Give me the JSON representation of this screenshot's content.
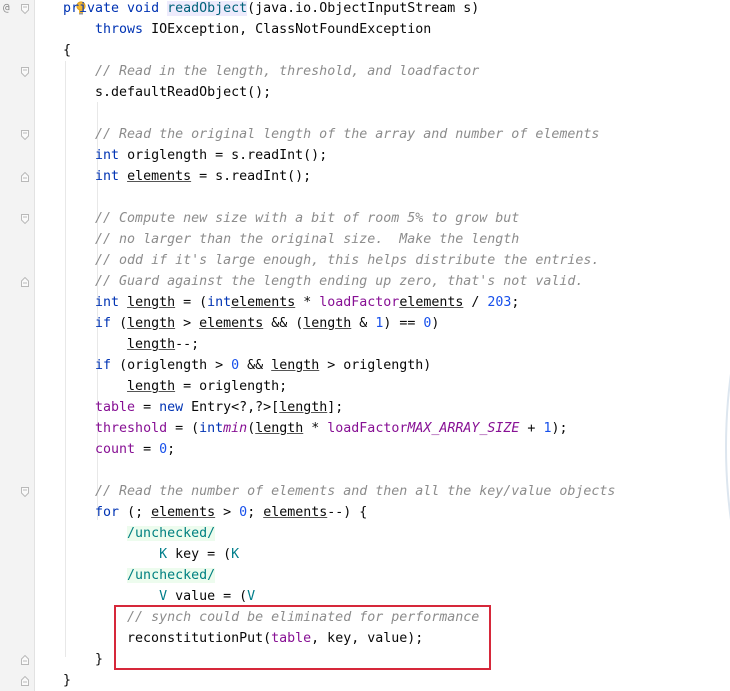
{
  "gutter": {
    "override_marker": "@"
  },
  "lines": [
    {
      "segs": [
        [
          "kw",
          "private "
        ],
        [
          "kw",
          "void "
        ],
        [
          "fn hl",
          "readObject"
        ],
        [
          "",
          "(java.io.ObjectInputStream s)"
        ]
      ]
    },
    {
      "segs": [
        [
          "",
          "    "
        ],
        [
          "kw",
          "throws "
        ],
        [
          "",
          "IOException, ClassNotFoundException"
        ]
      ]
    },
    {
      "segs": [
        [
          "",
          "{"
        ]
      ]
    },
    {
      "segs": [
        [
          "",
          "    "
        ],
        [
          "cm",
          "// Read in the length, threshold, and loadfactor"
        ]
      ]
    },
    {
      "segs": [
        [
          "",
          "    s.defaultReadObject();"
        ]
      ]
    },
    {
      "segs": [
        [
          "",
          ""
        ]
      ]
    },
    {
      "segs": [
        [
          "",
          "    "
        ],
        [
          "cm",
          "// Read the original length of the array and number of elements"
        ]
      ]
    },
    {
      "segs": [
        [
          "",
          "    "
        ],
        [
          "kw",
          "int "
        ],
        [
          "",
          "origlength = s.readInt();"
        ]
      ]
    },
    {
      "segs": [
        [
          "",
          "    "
        ],
        [
          "kw",
          "int "
        ],
        [
          "ul",
          "elements"
        ],
        [
          "",
          " = s.readInt();"
        ]
      ]
    },
    {
      "segs": [
        [
          "",
          ""
        ]
      ]
    },
    {
      "segs": [
        [
          "",
          "    "
        ],
        [
          "cm",
          "// Compute new size with a bit of room 5% to grow but"
        ]
      ]
    },
    {
      "segs": [
        [
          "",
          "    "
        ],
        [
          "cm",
          "// no larger than the original size.  Make the length"
        ]
      ]
    },
    {
      "segs": [
        [
          "",
          "    "
        ],
        [
          "cm",
          "// odd if it's large enough, this helps distribute the entries."
        ]
      ]
    },
    {
      "segs": [
        [
          "",
          "    "
        ],
        [
          "cm",
          "// Guard against the length ending up zero, that's not valid."
        ]
      ]
    },
    {
      "segs": [
        [
          "",
          "    "
        ],
        [
          "kw",
          "int "
        ],
        [
          "ul",
          "length"
        ],
        [
          "",
          " = ("
        ],
        [
          "kw",
          "int"
        ],
        [
          ")("
        ],
        [
          "ul",
          "elements"
        ],
        [
          "",
          " * "
        ],
        [
          "fld",
          "loadFactor"
        ],
        [
          ") + ("
        ],
        [
          "ul",
          "elements"
        ],
        [
          "",
          " / "
        ],
        [
          "num",
          "20"
        ],
        [
          ") + "
        ],
        [
          "num",
          "3"
        ],
        [
          "",
          ";"
        ]
      ]
    },
    {
      "segs": [
        [
          "",
          "    "
        ],
        [
          "kw",
          "if "
        ],
        [
          "",
          "("
        ],
        [
          "ul",
          "length"
        ],
        [
          "",
          " > "
        ],
        [
          "ul",
          "elements"
        ],
        [
          "",
          " && ("
        ],
        [
          "ul",
          "length"
        ],
        [
          "",
          " & "
        ],
        [
          "num",
          "1"
        ],
        [
          "",
          ") == "
        ],
        [
          "num",
          "0"
        ],
        [
          "",
          ")"
        ]
      ]
    },
    {
      "segs": [
        [
          "",
          "        "
        ],
        [
          "ul",
          "length"
        ],
        [
          "",
          "--;"
        ]
      ]
    },
    {
      "segs": [
        [
          "",
          "    "
        ],
        [
          "kw",
          "if "
        ],
        [
          "",
          "(origlength > "
        ],
        [
          "num",
          "0"
        ],
        [
          "",
          " && "
        ],
        [
          "ul",
          "length"
        ],
        [
          "",
          " > origlength)"
        ]
      ]
    },
    {
      "segs": [
        [
          "",
          "        "
        ],
        [
          "ul",
          "length"
        ],
        [
          "",
          " = origlength;"
        ]
      ]
    },
    {
      "segs": [
        [
          "",
          "    "
        ],
        [
          "fld",
          "table"
        ],
        [
          "",
          " = "
        ],
        [
          "kw",
          "new "
        ],
        [
          "",
          "Entry<?,?>["
        ],
        [
          "ul",
          "length"
        ],
        [
          "",
          "];"
        ]
      ]
    },
    {
      "segs": [
        [
          "",
          "    "
        ],
        [
          "fld",
          "threshold"
        ],
        [
          "",
          " = ("
        ],
        [
          "kw",
          "int"
        ],
        [
          ")Math."
        ],
        [
          "st",
          "min"
        ],
        [
          "",
          "("
        ],
        [
          "ul",
          "length"
        ],
        [
          "",
          " * "
        ],
        [
          "fld",
          "loadFactor"
        ],
        [
          ", "
        ],
        [
          "st",
          "MAX_ARRAY_SIZE"
        ],
        [
          "",
          " + "
        ],
        [
          "num",
          "1"
        ],
        [
          "",
          ");"
        ]
      ]
    },
    {
      "segs": [
        [
          "",
          "    "
        ],
        [
          "fld",
          "count"
        ],
        [
          "",
          " = "
        ],
        [
          "num",
          "0"
        ],
        [
          "",
          ";"
        ]
      ]
    },
    {
      "segs": [
        [
          "",
          ""
        ]
      ]
    },
    {
      "segs": [
        [
          "",
          "    "
        ],
        [
          "cm",
          "// Read the number of elements and then all the key/value objects"
        ]
      ]
    },
    {
      "segs": [
        [
          "",
          "    "
        ],
        [
          "kw",
          "for "
        ],
        [
          "",
          "(; "
        ],
        [
          "ul",
          "elements"
        ],
        [
          "",
          " > "
        ],
        [
          "num",
          "0"
        ],
        [
          "",
          "; "
        ],
        [
          "ul",
          "elements"
        ],
        [
          "",
          "--) {"
        ]
      ]
    },
    {
      "segs": [
        [
          "",
          "        "
        ],
        [
          "sup",
          "/unchecked/"
        ]
      ]
    },
    {
      "segs": [
        [
          "",
          "            "
        ],
        [
          "tp",
          "K"
        ],
        [
          "",
          " key = ("
        ],
        [
          "tp",
          "K"
        ],
        [
          ")s.readObject();"
        ]
      ]
    },
    {
      "segs": [
        [
          "",
          "        "
        ],
        [
          "sup",
          "/unchecked/"
        ]
      ]
    },
    {
      "segs": [
        [
          "",
          "            "
        ],
        [
          "tp",
          "V"
        ],
        [
          "",
          " value = ("
        ],
        [
          "tp",
          "V"
        ],
        [
          ")s.readObject();"
        ]
      ]
    },
    {
      "segs": [
        [
          "",
          "        "
        ],
        [
          "cm",
          "// synch could be eliminated for performance"
        ]
      ]
    },
    {
      "segs": [
        [
          "",
          "        reconstitutionPut("
        ],
        [
          "fld",
          "table"
        ],
        [
          "",
          ", key, value);"
        ]
      ]
    },
    {
      "segs": [
        [
          "",
          "    }"
        ]
      ]
    },
    {
      "segs": [
        [
          "",
          "}"
        ]
      ]
    }
  ],
  "folds": [
    {
      "line": 0,
      "kind": "open"
    },
    {
      "line": 3,
      "kind": "open"
    },
    {
      "line": 6,
      "kind": "open"
    },
    {
      "line": 8,
      "kind": "close"
    },
    {
      "line": 10,
      "kind": "open"
    },
    {
      "line": 13,
      "kind": "close"
    },
    {
      "line": 23,
      "kind": "open"
    },
    {
      "line": 31,
      "kind": "close"
    },
    {
      "line": 32,
      "kind": "close"
    }
  ]
}
